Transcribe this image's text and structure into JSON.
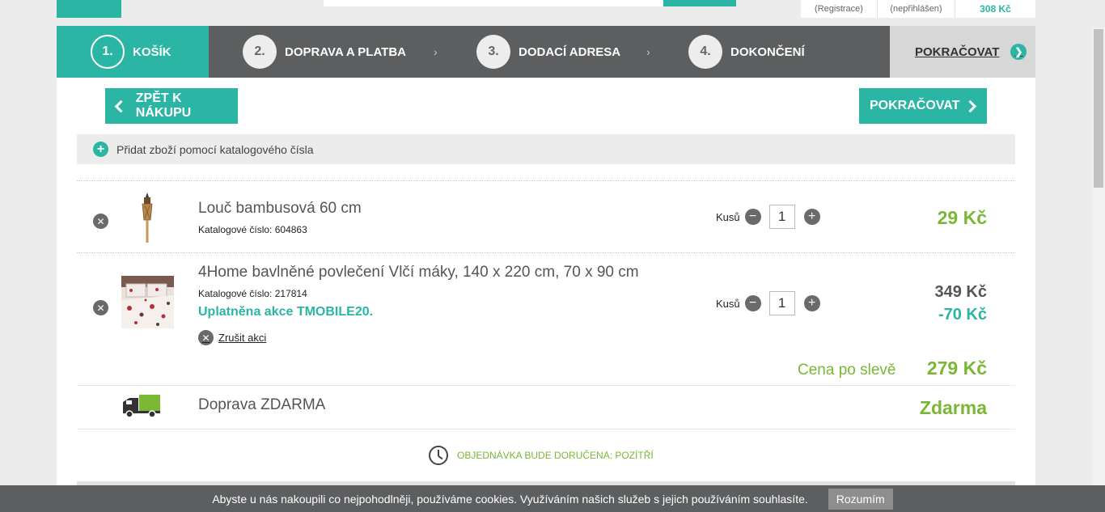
{
  "header": {
    "user_links": [
      "(Registrace)",
      "(nepřihlášen)"
    ],
    "cart_total": "308 Kč"
  },
  "steps": [
    {
      "num": "1.",
      "label": "KOŠÍK",
      "active": true
    },
    {
      "num": "2.",
      "label": "DOPRAVA A PLATBA"
    },
    {
      "num": "3.",
      "label": "DODACÍ ADRESA"
    },
    {
      "num": "4.",
      "label": "DOKONČENÍ"
    }
  ],
  "step_separator": "›",
  "steps_continue": "POKRAČOVAT",
  "buttons": {
    "back": "ZPĚT K NÁKUPU",
    "next": "POKRAČOVAT"
  },
  "add_by_catalog": "Přidat zboží pomocí katalogového čísla",
  "cart": {
    "qty_label": "Kusů",
    "items": [
      {
        "name": "Louč bambusová 60 cm",
        "catalog": "Katalogové číslo: 604863",
        "quantity": "1",
        "price": "29 Kč"
      },
      {
        "name": "4Home bavlněné povlečení Vlčí máky, 140 x 220 cm, 70 x 90 cm",
        "catalog": "Katalogové číslo: 217814",
        "promo": "Uplatněna akce TMOBILE20.",
        "cancel_promo": "Zrušit akci",
        "quantity": "1",
        "price": "349 Kč",
        "discount": "-70 Kč",
        "after_discount_label": "Cena po slevě",
        "after_discount_price": "279 Kč"
      }
    ],
    "shipping": {
      "name": "Doprava ZDARMA",
      "price": "Zdarma"
    },
    "delivery_note": "OBJEDNÁVKA BUDE DORUČENA: POZÍTŘÍ"
  },
  "cookie_bar": {
    "text": "Abyste u nás nakoupili co nejpohodlněji, používáme cookies. Využíváním našich služeb s jejich používáním souhlasíte.",
    "button": "Rozumím"
  },
  "colors": {
    "accent": "#2bb5a4",
    "price_green": "#7ab735",
    "bar_dark": "#5c5e60"
  }
}
